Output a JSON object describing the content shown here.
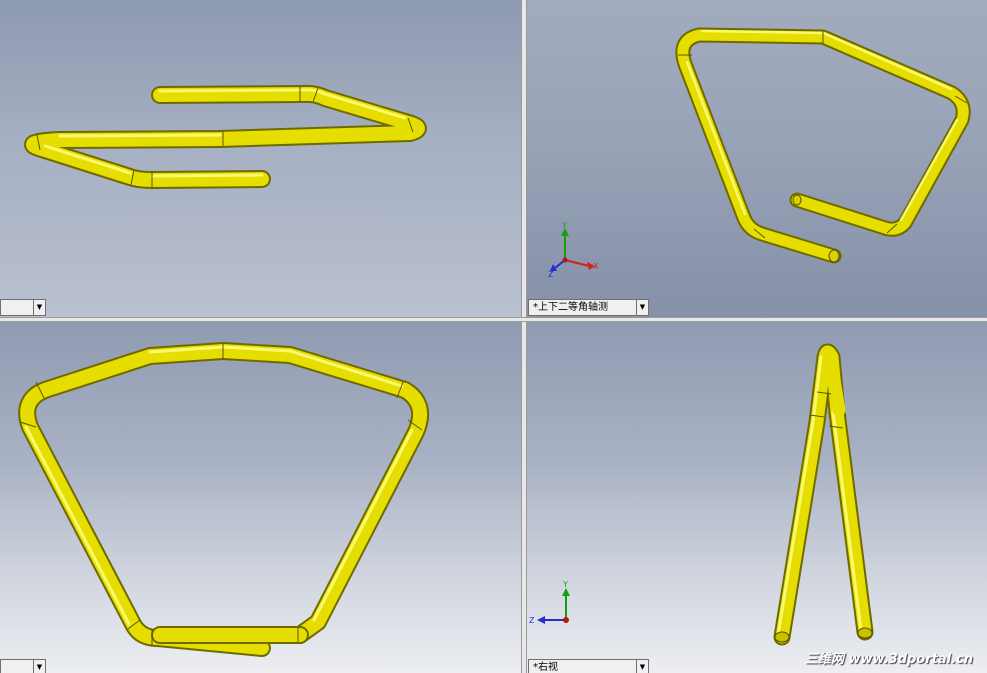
{
  "viewports": {
    "top_left": {
      "view_label": ""
    },
    "top_right": {
      "view_label": "*上下二等角轴测"
    },
    "bottom_left": {
      "view_label": ""
    },
    "bottom_right": {
      "view_label": "*右视"
    }
  },
  "triad": {
    "x": "X",
    "y": "Y",
    "z": "Z"
  },
  "watermark": "三维网 www.3dportal.cn",
  "colors": {
    "tube": "#e8e000",
    "tube_highlight": "#ffff6a",
    "tube_shadow": "#8a8400",
    "axis_x": "#d02020",
    "axis_y": "#10a010",
    "axis_z": "#2030d0"
  }
}
